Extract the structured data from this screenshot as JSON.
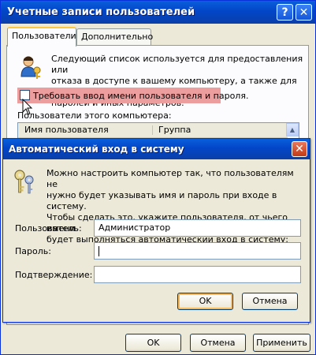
{
  "outer_window": {
    "title": "Учетные записи пользователей",
    "help_glyph": "?",
    "close_glyph": "✕",
    "tabs": [
      "Пользователи",
      "Дополнительно"
    ],
    "intro_text": "Следующий список используется для предоставления или\nотказа в доступе к вашему компьютеру, а также для смены\nпаролей и иных параметров.",
    "require_password_label": "Требовать ввод имени пользователя и пароля.",
    "require_password_checked": false,
    "users_label": "Пользователи этого компьютера:",
    "columns": [
      "Имя пользователя",
      "Группа"
    ],
    "buttons": {
      "ok": "OK",
      "cancel": "Отмена",
      "apply": "Применить"
    }
  },
  "auto_logon_dialog": {
    "title": "Автоматический вход в систему",
    "close_glyph": "✕",
    "description": "Можно настроить компьютер так, что пользователям не\nнужно будет указывать имя и пароль при входе в систему.\nЧтобы сделать это, укажите пользователя, от чьего имени\nбудет выполняться автоматический вход в систему:",
    "fields": {
      "user_label": "Пользователь:",
      "user_value": "Администратор",
      "password_label": "Пароль:",
      "password_value": "",
      "confirm_label": "Подтверждение:",
      "confirm_value": ""
    },
    "buttons": {
      "ok": "OK",
      "cancel": "Отмена"
    }
  },
  "colors": {
    "titlebar": "#0246c8",
    "dialog_bg": "#ece9d8",
    "highlight": "#ec9e9e",
    "close_red": "#c13a15"
  }
}
